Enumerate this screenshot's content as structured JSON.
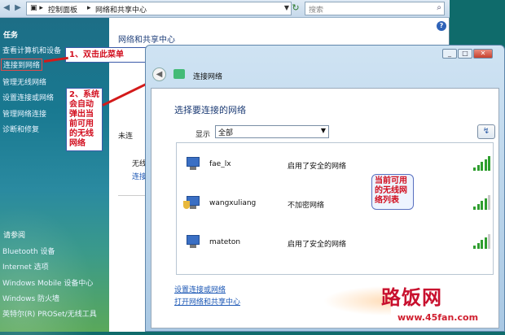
{
  "addressbar": {
    "crumbs": [
      "控制面板",
      "网络和共享中心"
    ],
    "search_placeholder": "搜索"
  },
  "sidebar": {
    "tasks_heading": "任务",
    "tasks": [
      "查看计算机和设备",
      "连接到网络",
      "管理无线网络",
      "设置连接或网络",
      "管理网络连接",
      "诊断和修复"
    ],
    "selected_index": 1,
    "see_also_heading": "请参阅",
    "see_also": [
      "Bluetooth 设备",
      "Internet 选项",
      "Windows Mobile 设备中心",
      "Windows 防火墙",
      "英特尔(R) PROSet/无线工具"
    ]
  },
  "main": {
    "title": "网络和共享中心",
    "help": "?",
    "fragments": [
      "未连",
      "无线",
      "连接"
    ]
  },
  "annotations": {
    "note1": "1、双击此菜单",
    "note2": "2、系统会自动弹出当前可用的无线网络",
    "note3": "当前可用的无线网络列表"
  },
  "dialog": {
    "header_title": "连接网络",
    "heading": "选择要连接的网络",
    "show_label": "显示",
    "show_value": "全部",
    "networks": [
      {
        "name": "fae_lx",
        "security": "启用了安全的网络",
        "signal": 5
      },
      {
        "name": "wangxuliang",
        "security": "不加密网络",
        "signal": 4
      },
      {
        "name": "mateton",
        "security": "启用了安全的网络",
        "signal": 4
      }
    ],
    "links": [
      "设置连接或网络",
      "打开网络和共享中心"
    ]
  },
  "watermark": {
    "brand": "路饭网",
    "url": "www.45fan.com"
  },
  "colors": {
    "annotation_red": "#d20f1f",
    "link_blue": "#1b57b5",
    "signal_green": "#2f9e2f"
  }
}
